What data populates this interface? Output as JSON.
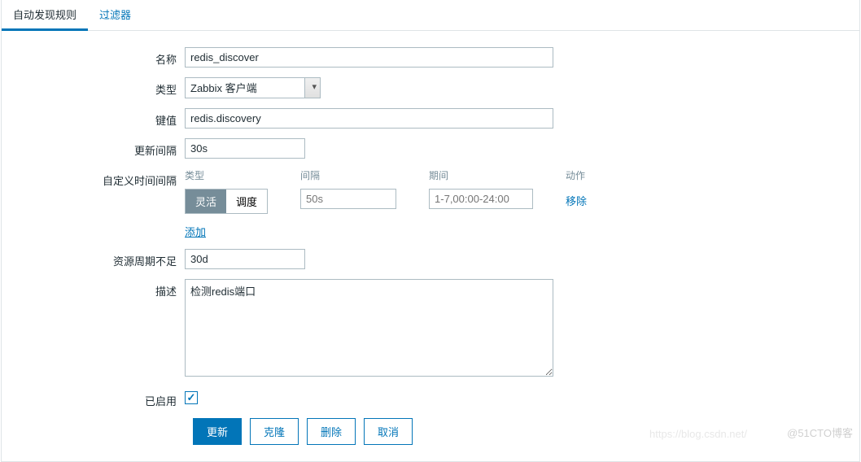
{
  "tabs": {
    "active": "自动发现规则",
    "filter": "过滤器"
  },
  "form": {
    "name_label": "名称",
    "name_value": "redis_discover",
    "type_label": "类型",
    "type_value": "Zabbix 客户端",
    "key_label": "键值",
    "key_value": "redis.discovery",
    "interval_label": "更新间隔",
    "interval_value": "30s",
    "custom_interval_label": "自定义时间间隔",
    "custom_interval": {
      "col_type": "类型",
      "col_interval": "间隔",
      "col_period": "期间",
      "col_action": "动作",
      "toggle_flexible": "灵活",
      "toggle_scheduling": "调度",
      "interval_placeholder": "50s",
      "period_placeholder": "1-7,00:00-24:00",
      "remove": "移除",
      "add": "添加"
    },
    "resource_label": "资源周期不足",
    "resource_value": "30d",
    "description_label": "描述",
    "description_value": "检测redis端口",
    "enabled_label": "已启用",
    "enabled_checked": true
  },
  "buttons": {
    "update": "更新",
    "clone": "克隆",
    "delete": "删除",
    "cancel": "取消"
  },
  "watermark": "@51CTO博客",
  "watermark2": "https://blog.csdn.net/"
}
